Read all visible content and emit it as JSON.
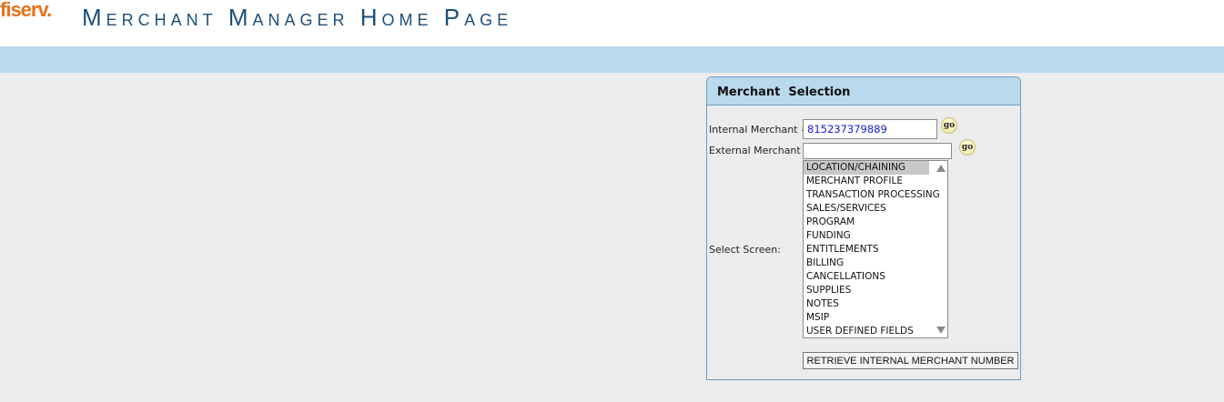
{
  "header": {
    "logo": "fiserv.",
    "title": "Merchant Manager Home Page"
  },
  "panel": {
    "title": "Merchant  Selection",
    "internal_label": "Internal Merchant #:",
    "internal_value": "815237379889",
    "internal_go": "go",
    "external_label": "External Merchant #:",
    "external_value": "",
    "external_go": "go",
    "select_label": "Select Screen:",
    "screens": [
      "LOCATION/CHAINING",
      "MERCHANT PROFILE",
      "TRANSACTION PROCESSING",
      "SALES/SERVICES",
      "PROGRAM",
      "FUNDING",
      "ENTITLEMENTS",
      "BILLING",
      "CANCELLATIONS",
      "SUPPLIES",
      "NOTES",
      "MSIP",
      "USER DEFINED FIELDS"
    ],
    "selected_screen": "LOCATION/CHAINING",
    "retrieve_button": "RETRIEVE INTERNAL MERCHANT NUMBER"
  },
  "colors": {
    "logo": "#e8711c",
    "title": "#1d4f7a",
    "band": "#b9d9ec",
    "background": "#ececec",
    "input_text": "#1a1ad8"
  }
}
